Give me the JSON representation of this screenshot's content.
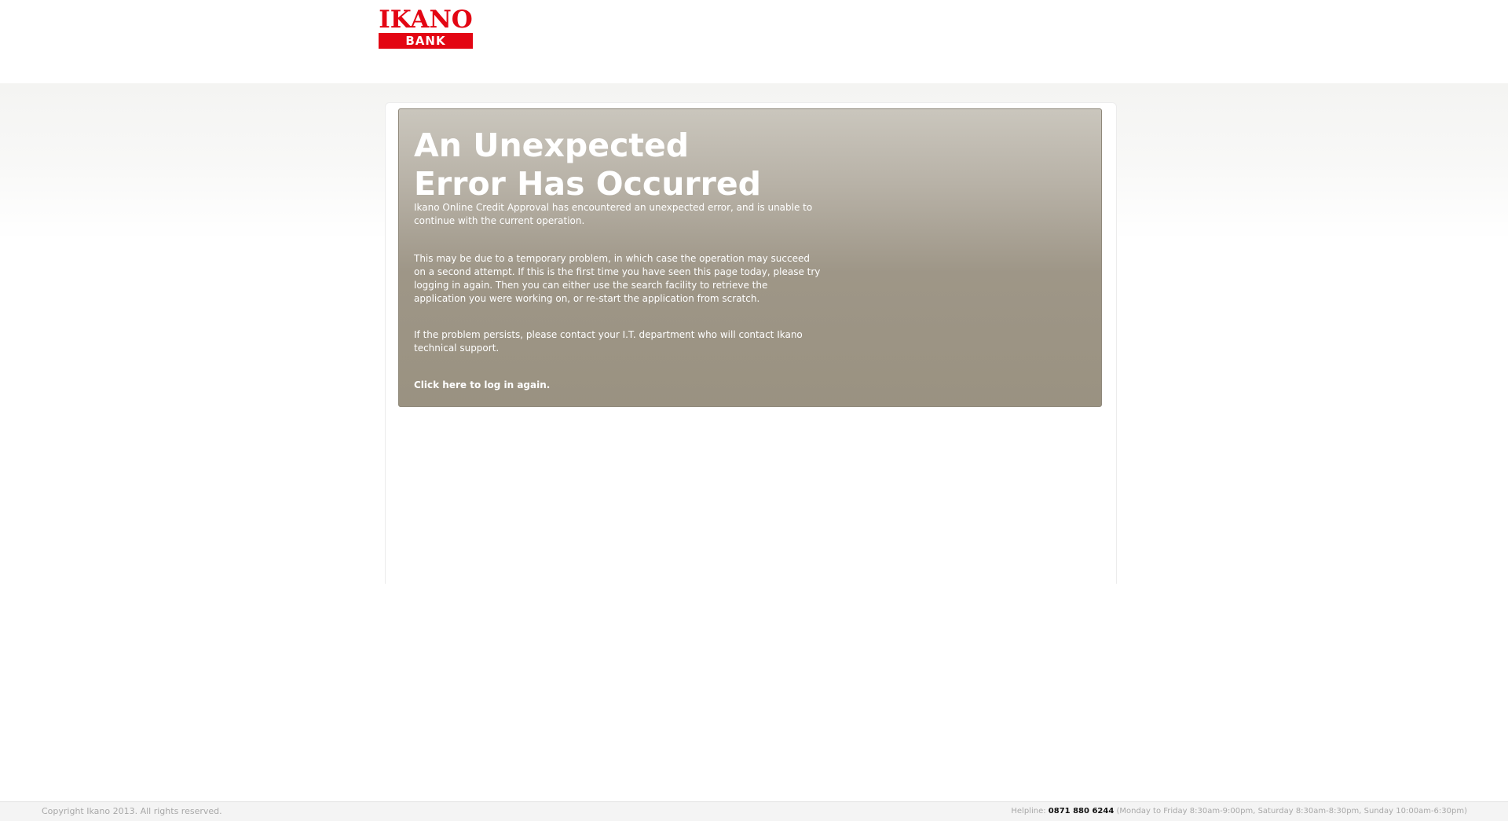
{
  "brand": {
    "logo_word": "IKANO",
    "logo_sub": "BANK",
    "color": "#e30613"
  },
  "error": {
    "title_line1": "An Unexpected",
    "title_line2": "Error Has Occurred",
    "paragraph1": "Ikano Online Credit Approval has encountered an unexpected error, and is unable to continue with the current operation.",
    "paragraph2": "This may be due to a temporary problem, in which case the operation may succeed on a second attempt. If this is the first time you have seen this page today, please try logging in again. Then you can either use the search facility to retrieve the application you were working on, or re-start the application from scratch.",
    "paragraph3": "If the problem persists, please contact your I.T. department who will contact Ikano technical support.",
    "login_link": "Click here to log in again."
  },
  "footer": {
    "copyright": "Copyright Ikano 2013. All rights reserved.",
    "helpline_label": "Helpline:",
    "helpline_number": "0871 880 6244",
    "helpline_hours": "(Monday to Friday 8:30am-9:00pm, Saturday 8:30am-8:30pm, Sunday 10:00am-6:30pm)"
  }
}
